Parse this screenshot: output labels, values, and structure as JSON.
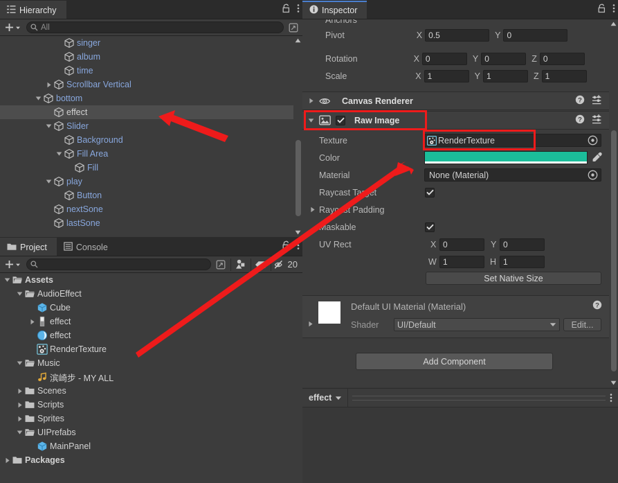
{
  "hierarchy": {
    "tab_label": "Hierarchy",
    "tab_icon": "hierarchy-icon",
    "lock_icon": "lock-icon",
    "menu_icon": "kebab-menu-icon",
    "add_label": "+",
    "search_placeholder": "All",
    "items": [
      {
        "label": "singer",
        "indent": 5,
        "expand": "none",
        "icon": "gameobject-cube-icon",
        "color": "blue",
        "selected": false
      },
      {
        "label": "album",
        "indent": 5,
        "expand": "none",
        "icon": "gameobject-cube-icon",
        "color": "blue",
        "selected": false
      },
      {
        "label": "time",
        "indent": 5,
        "expand": "none",
        "icon": "gameobject-cube-icon",
        "color": "blue",
        "selected": false
      },
      {
        "label": "Scrollbar Vertical",
        "indent": 4,
        "expand": "collapsed",
        "icon": "gameobject-cube-icon",
        "color": "blue",
        "selected": false
      },
      {
        "label": "bottom",
        "indent": 3,
        "expand": "expanded",
        "icon": "gameobject-cube-icon",
        "color": "blue",
        "selected": false
      },
      {
        "label": "effect",
        "indent": 4,
        "expand": "none",
        "icon": "gameobject-cube-icon",
        "color": "white",
        "selected": true
      },
      {
        "label": "Slider",
        "indent": 4,
        "expand": "expanded",
        "icon": "gameobject-cube-icon",
        "color": "blue",
        "selected": false
      },
      {
        "label": "Background",
        "indent": 5,
        "expand": "none",
        "icon": "gameobject-cube-icon",
        "color": "blue",
        "selected": false
      },
      {
        "label": "Fill Area",
        "indent": 5,
        "expand": "expanded",
        "icon": "gameobject-cube-icon",
        "color": "blue",
        "selected": false
      },
      {
        "label": "Fill",
        "indent": 6,
        "expand": "none",
        "icon": "gameobject-cube-icon",
        "color": "blue",
        "selected": false
      },
      {
        "label": "play",
        "indent": 4,
        "expand": "expanded",
        "icon": "gameobject-cube-icon",
        "color": "blue",
        "selected": false
      },
      {
        "label": "Button",
        "indent": 5,
        "expand": "none",
        "icon": "gameobject-cube-icon",
        "color": "blue",
        "selected": false
      },
      {
        "label": "nextSone",
        "indent": 4,
        "expand": "none",
        "icon": "gameobject-cube-icon",
        "color": "blue",
        "selected": false
      },
      {
        "label": "lastSone",
        "indent": 4,
        "expand": "none",
        "icon": "gameobject-cube-icon",
        "color": "blue",
        "selected": false
      }
    ]
  },
  "project": {
    "tabs": [
      {
        "label": "Project",
        "icon": "folder-icon",
        "active": true
      },
      {
        "label": "Console",
        "icon": "console-icon",
        "active": false
      }
    ],
    "lock_icon": "lock-icon",
    "menu_icon": "kebab-menu-icon",
    "add_label": "+",
    "search_placeholder": "",
    "search_value": "",
    "type_filter_icon": "search-by-type-icon",
    "label_filter_icon": "search-by-label-icon",
    "hidden_count_icon": "eye-slash-icon",
    "hidden_count": "20",
    "items": [
      {
        "label": "Assets",
        "indent": 0,
        "expand": "expanded",
        "icon": "folder-open-icon",
        "bold": true,
        "selected": false
      },
      {
        "label": "AudioEffect",
        "indent": 1,
        "expand": "expanded",
        "icon": "folder-open-icon",
        "bold": false,
        "selected": false
      },
      {
        "label": "Cube",
        "indent": 2,
        "expand": "none",
        "icon": "prefab-cube-icon",
        "bold": false,
        "selected": false
      },
      {
        "label": "effect",
        "indent": 2,
        "expand": "collapsed",
        "icon": "shader-icon",
        "bold": false,
        "selected": false
      },
      {
        "label": "effect",
        "indent": 2,
        "expand": "none",
        "icon": "material-icon",
        "bold": false,
        "selected": false
      },
      {
        "label": "RenderTexture",
        "indent": 2,
        "expand": "none",
        "icon": "rendertexture-icon",
        "bold": false,
        "selected": false
      },
      {
        "label": "Music",
        "indent": 1,
        "expand": "expanded",
        "icon": "folder-open-icon",
        "bold": false,
        "selected": false
      },
      {
        "label": "滨崎步 - MY ALL",
        "indent": 2,
        "expand": "none",
        "icon": "audioclip-icon",
        "bold": false,
        "selected": false
      },
      {
        "label": "Scenes",
        "indent": 1,
        "expand": "collapsed",
        "icon": "folder-icon",
        "bold": false,
        "selected": false
      },
      {
        "label": "Scripts",
        "indent": 1,
        "expand": "collapsed",
        "icon": "folder-icon",
        "bold": false,
        "selected": false
      },
      {
        "label": "Sprites",
        "indent": 1,
        "expand": "collapsed",
        "icon": "folder-icon",
        "bold": false,
        "selected": false
      },
      {
        "label": "UIPrefabs",
        "indent": 1,
        "expand": "expanded",
        "icon": "folder-open-icon",
        "bold": false,
        "selected": false
      },
      {
        "label": "MainPanel",
        "indent": 2,
        "expand": "none",
        "icon": "prefab-cube-icon",
        "bold": false,
        "selected": false
      },
      {
        "label": "Packages",
        "indent": 0,
        "expand": "collapsed",
        "icon": "folder-icon",
        "bold": true,
        "selected": false
      }
    ]
  },
  "inspector": {
    "tab_label": "Inspector",
    "tab_icon": "info-icon",
    "lock_icon": "lock-icon",
    "menu_icon": "kebab-menu-icon",
    "clipped_label": "Anchors",
    "transform": {
      "pivot": {
        "label": "Pivot",
        "x_axis": "X",
        "x": "0.5",
        "y_axis": "Y",
        "y": "0"
      },
      "rotation": {
        "label": "Rotation",
        "x_axis": "X",
        "x": "0",
        "y_axis": "Y",
        "y": "0",
        "z_axis": "Z",
        "z": "0"
      },
      "scale": {
        "label": "Scale",
        "x_axis": "X",
        "x": "1",
        "y_axis": "Y",
        "y": "1",
        "z_axis": "Z",
        "z": "1"
      }
    },
    "canvas_renderer": {
      "title": "Canvas Renderer",
      "icon": "eye-icon",
      "help_icon": "help-icon",
      "preset_icon": "preset-icon",
      "menu_icon": "kebab-menu-icon",
      "expanded": false
    },
    "raw_image": {
      "title": "Raw Image",
      "icon": "raw-image-icon",
      "enabled": true,
      "help_icon": "help-icon",
      "preset_icon": "preset-icon",
      "menu_icon": "kebab-menu-icon",
      "expanded": true,
      "texture": {
        "label": "Texture",
        "value": "RenderTexture",
        "icon": "rendertexture-icon",
        "picker_icon": "object-picker-icon"
      },
      "color": {
        "label": "Color",
        "swatch": "#1bbd9a",
        "alpha": "#ffffff",
        "eyedropper_icon": "eyedropper-icon"
      },
      "material": {
        "label": "Material",
        "value": "None (Material)",
        "picker_icon": "object-picker-icon"
      },
      "raycast_target": {
        "label": "Raycast Target",
        "checked": true
      },
      "raycast_padding": {
        "label": "Raycast Padding",
        "expand": "collapsed"
      },
      "maskable": {
        "label": "Maskable",
        "checked": true
      },
      "uv_rect": {
        "label": "UV Rect",
        "x_axis": "X",
        "x": "0",
        "y_axis": "Y",
        "y": "0",
        "w_axis": "W",
        "w": "1",
        "h_axis": "H",
        "h": "1"
      },
      "set_native_size": "Set Native Size"
    },
    "material_preview": {
      "title": "Default UI Material (Material)",
      "help_icon": "help-icon",
      "menu_icon": "kebab-menu-icon",
      "shader_label": "Shader",
      "shader_value": "UI/Default",
      "dropdown_icon": "chevron-down-icon",
      "edit_label": "Edit..."
    },
    "add_component": "Add Component",
    "preview_bar": {
      "name": "effect",
      "dropdown_icon": "chevron-down-icon",
      "menu_icon": "kebab-menu-icon"
    }
  },
  "annotations": {
    "arrow_color": "#ee1b1b",
    "highlight_color": "#ee1b1b"
  }
}
